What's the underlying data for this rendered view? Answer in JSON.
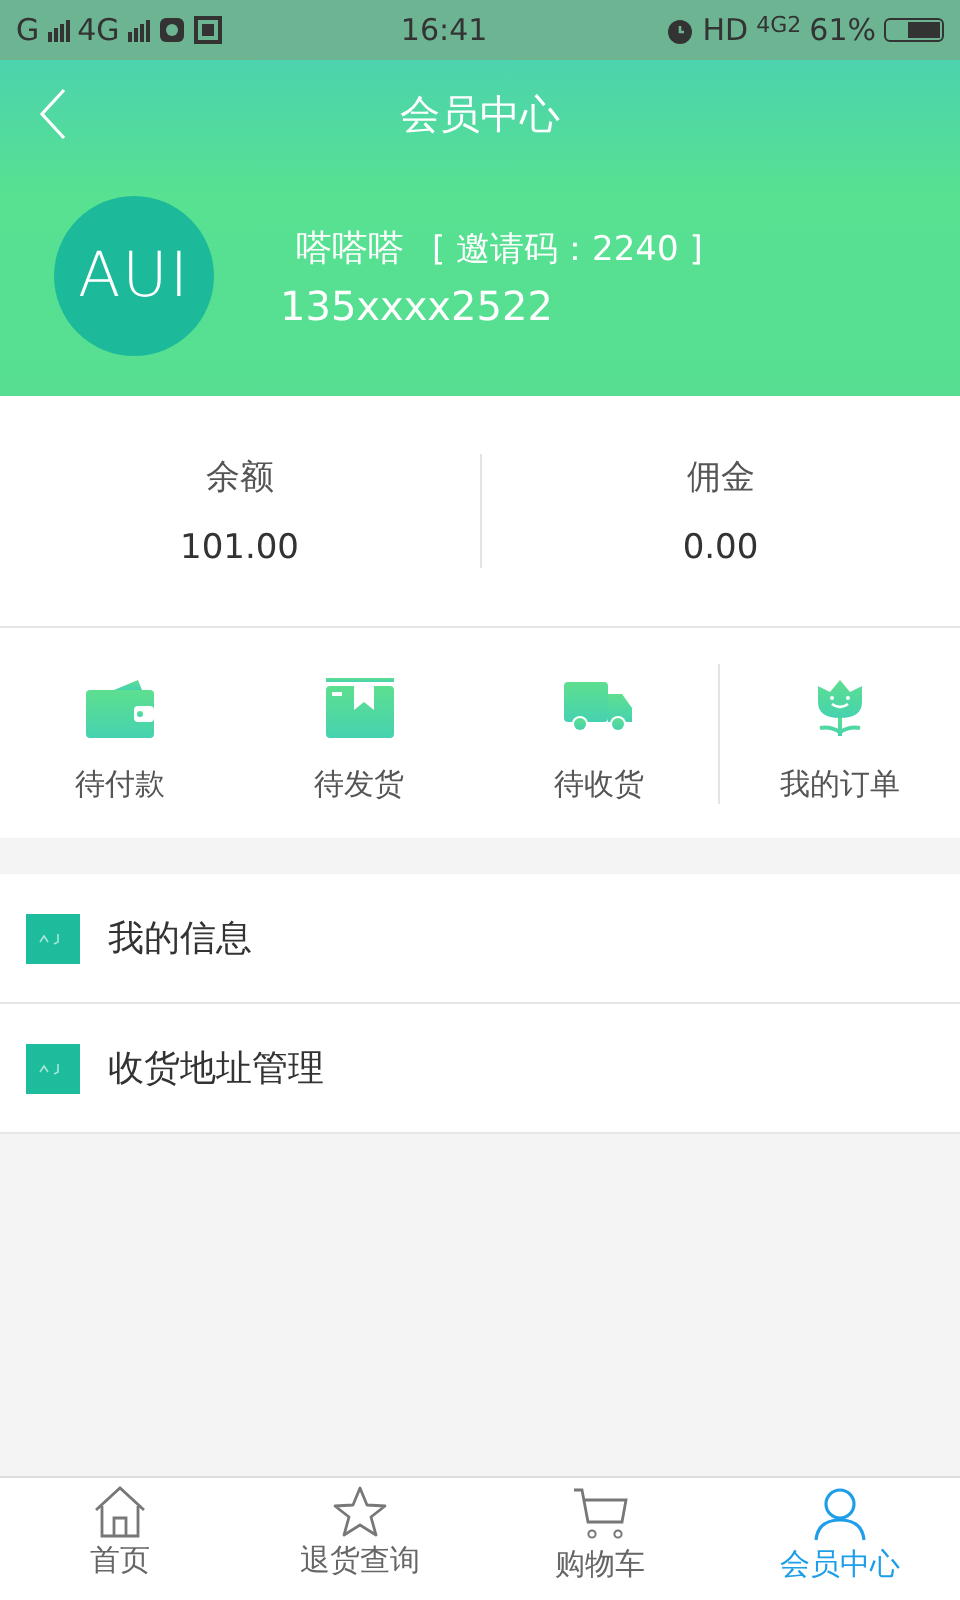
{
  "status_bar": {
    "signal_1": "G",
    "signal_2": "4G",
    "time": "16:41",
    "hd": "HD",
    "network": "4G2",
    "battery": "61%"
  },
  "nav": {
    "title": "会员中心"
  },
  "profile": {
    "avatar": "AUI",
    "name": "嗒嗒嗒",
    "invite": "[ 邀请码：2240 ]",
    "phone": "135xxxx2522"
  },
  "stats": [
    {
      "label": "余额",
      "value": "101.00"
    },
    {
      "label": "佣金",
      "value": "0.00"
    }
  ],
  "orders": [
    {
      "kind": "wallet",
      "label": "待付款"
    },
    {
      "kind": "box",
      "label": "待发货"
    },
    {
      "kind": "truck",
      "label": "待收货"
    },
    {
      "kind": "flower",
      "label": "我的订单"
    }
  ],
  "menu": [
    {
      "label": "我的信息"
    },
    {
      "label": "收货地址管理"
    }
  ],
  "tabs": [
    {
      "kind": "home",
      "label": "首页",
      "selected": false
    },
    {
      "kind": "star",
      "label": "退货查询",
      "selected": false
    },
    {
      "kind": "cart",
      "label": "购物车",
      "selected": false
    },
    {
      "kind": "user",
      "label": "会员中心",
      "selected": true
    }
  ]
}
